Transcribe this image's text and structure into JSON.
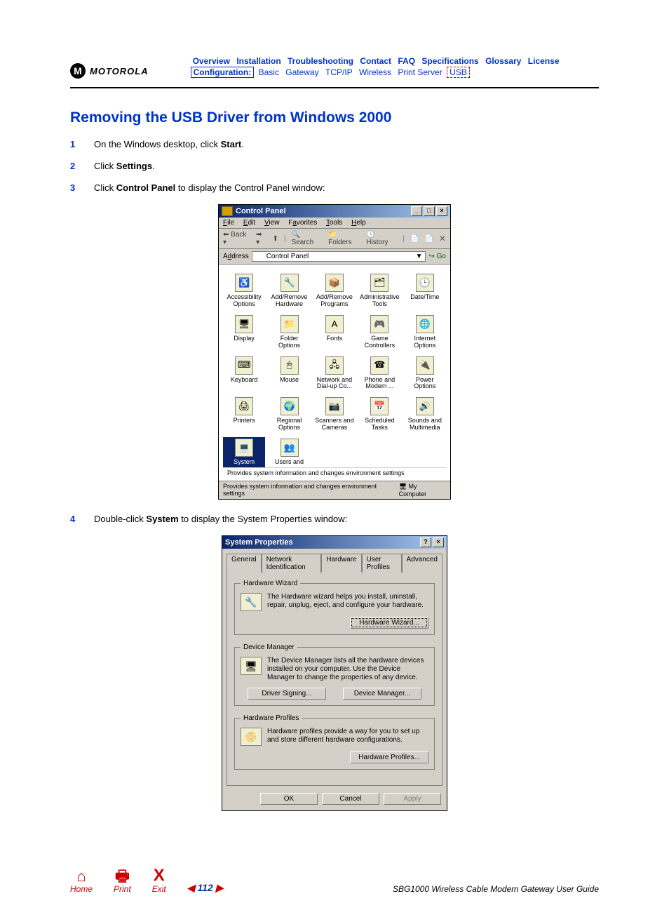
{
  "logo": {
    "mark": "M",
    "text": "MOTOROLA"
  },
  "nav_top": [
    "Overview",
    "Installation",
    "Troubleshooting",
    "Contact",
    "FAQ",
    "Specifications",
    "Glossary",
    "License"
  ],
  "nav_bot": {
    "label": "Configuration:",
    "items": [
      "Basic",
      "Gateway",
      "TCP/IP",
      "Wireless",
      "Print Server"
    ],
    "usb": "USB"
  },
  "title": "Removing the USB Driver from Windows 2000",
  "steps": {
    "s1a": "On the Windows desktop, click ",
    "s1b": "Start",
    "s1c": ".",
    "s2a": "Click ",
    "s2b": "Settings",
    "s2c": ".",
    "s3a": "Click ",
    "s3b": "Control Panel",
    "s3c": " to display the Control Panel window:",
    "s4a": "Double-click ",
    "s4b": "System",
    "s4c": " to display the System Properties window:"
  },
  "cp": {
    "title": "Control Panel",
    "menu": [
      "File",
      "Edit",
      "View",
      "Favorites",
      "Tools",
      "Help"
    ],
    "toolbar": {
      "back": "Back",
      "search": "Search",
      "folders": "Folders",
      "history": "History"
    },
    "address_label": "Address",
    "address_value": "Control Panel",
    "go": "Go",
    "items": [
      {
        "label": "Accessibility Options",
        "glyph": "♿"
      },
      {
        "label": "Add/Remove Hardware",
        "glyph": "🔧"
      },
      {
        "label": "Add/Remove Programs",
        "glyph": "📦"
      },
      {
        "label": "Administrative Tools",
        "glyph": "🗂"
      },
      {
        "label": "Date/Time",
        "glyph": "🕒"
      },
      {
        "label": "Display",
        "glyph": "🖥"
      },
      {
        "label": "Folder Options",
        "glyph": "📁"
      },
      {
        "label": "Fonts",
        "glyph": "A"
      },
      {
        "label": "Game Controllers",
        "glyph": "🎮"
      },
      {
        "label": "Internet Options",
        "glyph": "🌐"
      },
      {
        "label": "Keyboard",
        "glyph": "⌨"
      },
      {
        "label": "Mouse",
        "glyph": "🖱"
      },
      {
        "label": "Network and Dial-up Co...",
        "glyph": "🖧"
      },
      {
        "label": "Phone and Modem ...",
        "glyph": "☎"
      },
      {
        "label": "Power Options",
        "glyph": "🔌"
      },
      {
        "label": "Printers",
        "glyph": "🖨"
      },
      {
        "label": "Regional Options",
        "glyph": "🌍"
      },
      {
        "label": "Scanners and Cameras",
        "glyph": "📷"
      },
      {
        "label": "Scheduled Tasks",
        "glyph": "📅"
      },
      {
        "label": "Sounds and Multimedia",
        "glyph": "🔊"
      },
      {
        "label": "System",
        "glyph": "💻",
        "selected": true
      },
      {
        "label": "Users and",
        "glyph": "👥"
      }
    ],
    "desc": "Provides system information and changes environment settings",
    "status_left": "Provides system information and changes environment settings",
    "status_right": "My Computer"
  },
  "sp": {
    "title": "System Properties",
    "tabs": [
      "General",
      "Network Identification",
      "Hardware",
      "User Profiles",
      "Advanced"
    ],
    "active_tab": 2,
    "hw_wizard": {
      "legend": "Hardware Wizard",
      "text": "The Hardware wizard helps you install, uninstall, repair, unplug, eject, and configure your hardware.",
      "btn": "Hardware Wizard..."
    },
    "dev_mgr": {
      "legend": "Device Manager",
      "text": "The Device Manager lists all the hardware devices installed on your computer. Use the Device Manager to change the properties of any device.",
      "btn1": "Driver Signing...",
      "btn2": "Device Manager..."
    },
    "hw_prof": {
      "legend": "Hardware Profiles",
      "text": "Hardware profiles provide a way for you to set up and store different hardware configurations.",
      "btn": "Hardware Profiles..."
    },
    "footer": {
      "ok": "OK",
      "cancel": "Cancel",
      "apply": "Apply"
    }
  },
  "footer": {
    "home": "Home",
    "print": "Print",
    "exit": "Exit",
    "page": "112",
    "guide": "SBG1000 Wireless Cable Modem Gateway User Guide"
  }
}
